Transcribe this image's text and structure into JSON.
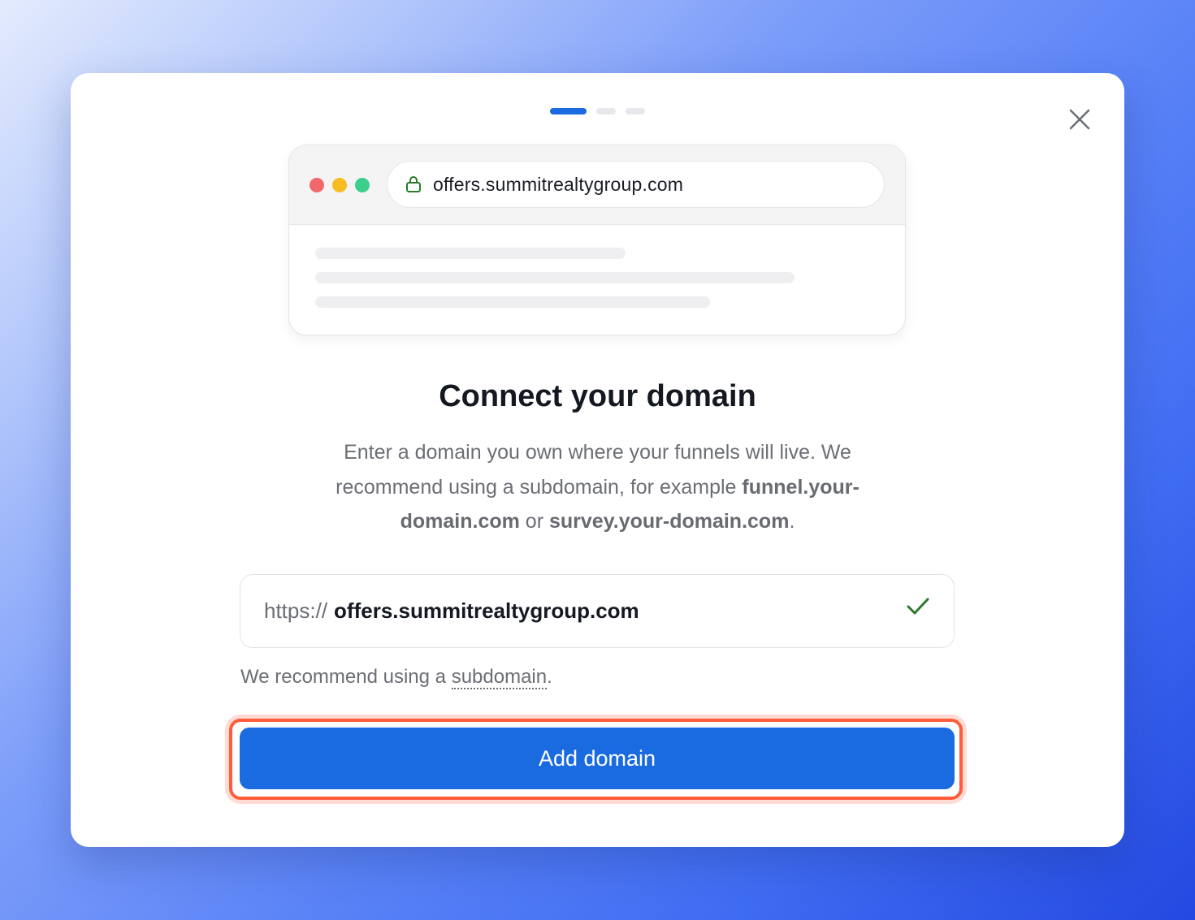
{
  "modal": {
    "steps": [
      {
        "active": true
      },
      {
        "active": false
      },
      {
        "active": false
      }
    ],
    "close_icon": "close-icon",
    "preview": {
      "url": "offers.summitrealtygroup.com",
      "lock_icon": "lock-icon"
    },
    "title": "Connect your domain",
    "description": {
      "part1": "Enter a domain you own where your funnels will live. We recommend using a subdomain, for example ",
      "example1": "funnel.your-domain.com",
      "middle": " or ",
      "example2": "survey.your-domain.com",
      "end": "."
    },
    "domain_input": {
      "prefix": "https://",
      "value": "offers.summitrealtygroup.com",
      "valid_icon": "check-icon"
    },
    "hint": {
      "text": "We recommend using a ",
      "link": "subdomain",
      "end": "."
    },
    "add_button_label": "Add domain"
  },
  "colors": {
    "primary": "#1a6be0",
    "highlight": "#ff5c3a",
    "success": "#2a7a2a"
  }
}
